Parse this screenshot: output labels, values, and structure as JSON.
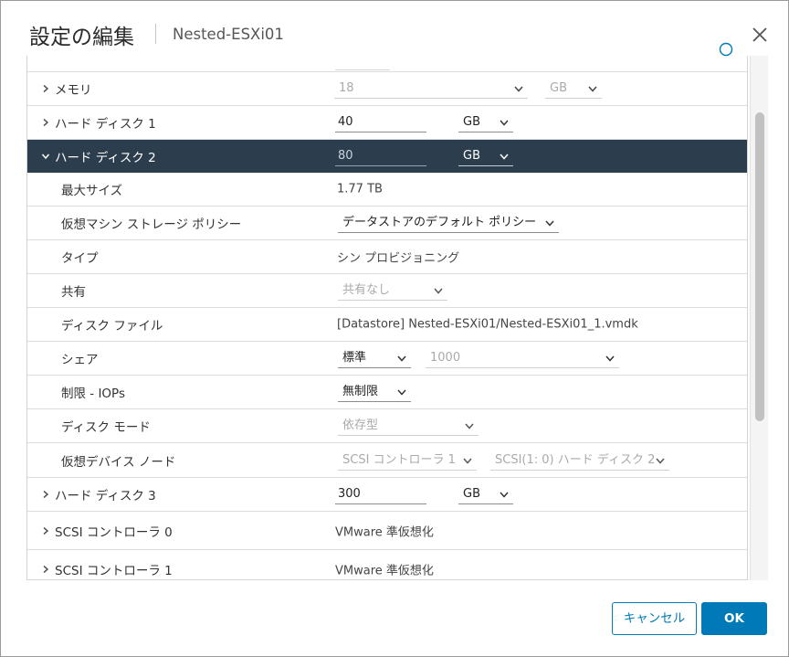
{
  "dialog": {
    "title": "設定の編集",
    "subtitle": "Nested-ESXi01"
  },
  "rows": {
    "memory": {
      "label": "メモリ",
      "value": "18",
      "unit": "GB"
    },
    "hd1": {
      "label": "ハード ディスク 1",
      "value": "40",
      "unit": "GB"
    },
    "hd2": {
      "label": "ハード ディスク 2",
      "value": "80",
      "unit": "GB",
      "max_size_label": "最大サイズ",
      "max_size_value": "1.77 TB",
      "policy_label": "仮想マシン ストレージ ポリシー",
      "policy_value": "データストアのデフォルト ポリシー",
      "type_label": "タイプ",
      "type_value": "シン プロビジョニング",
      "sharing_label": "共有",
      "sharing_value": "共有なし",
      "file_label": "ディスク ファイル",
      "file_value": "[Datastore] Nested-ESXi01/Nested-ESXi01_1.vmdk",
      "shares_label": "シェア",
      "shares_level": "標準",
      "shares_value": "1000",
      "limit_label": "制限 - IOPs",
      "limit_value": "無制限",
      "mode_label": "ディスク モード",
      "mode_value": "依存型",
      "node_label": "仮想デバイス ノード",
      "node_controller": "SCSI コントローラ 1",
      "node_slot": "SCSI(1: 0) ハード ディスク 2"
    },
    "hd3": {
      "label": "ハード ディスク 3",
      "value": "300",
      "unit": "GB"
    },
    "scsi0": {
      "label": "SCSI コントローラ 0",
      "value": "VMware 準仮想化"
    },
    "scsi1": {
      "label": "SCSI コントローラ 1",
      "value": "VMware 準仮想化"
    }
  },
  "footer": {
    "cancel_label": "キャンセル",
    "ok_label": "OK"
  },
  "colors": {
    "accent": "#0079b8",
    "selected_row": "#2c3e4e"
  },
  "icons": {
    "close": "close-icon",
    "expand": "chevron-right-icon",
    "collapse": "chevron-down-icon",
    "dropdown": "dropdown-caret-icon"
  }
}
